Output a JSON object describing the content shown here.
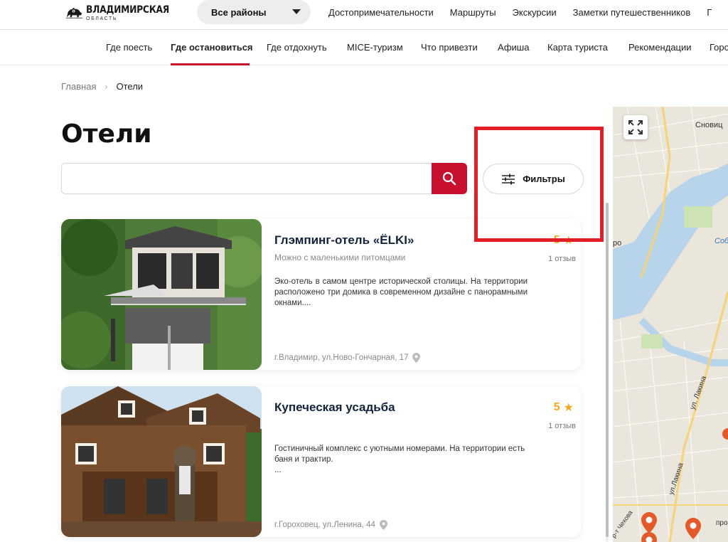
{
  "header": {
    "logo_title": "ВЛАДИМИРСКАЯ",
    "logo_subtitle": "ОБЛАСТЬ",
    "region_select": "Все районы",
    "nav": [
      "Достопримечательности",
      "Маршруты",
      "Экскурсии",
      "Заметки путешественников",
      "Г"
    ]
  },
  "subnav": {
    "items": [
      "Где поесть",
      "Где остановиться",
      "Где отдохнуть",
      "MICE-туризм",
      "Что привезти",
      "Афиша",
      "Карта туриста",
      "Рекомендации",
      "Горо"
    ],
    "active": "Где остановиться"
  },
  "breadcrumb": {
    "home": "Главная",
    "current": "Отели"
  },
  "page": {
    "title": "Отели",
    "search_placeholder": "",
    "filters_label": "Фильтры"
  },
  "hotels": [
    {
      "name": "Глэмпинг-отель «ЁLKI»",
      "tag": "Можно с маленькими питомцами",
      "description": "Эко-отель в самом центре исторической столицы. На территории расположено три домика в современном дизайне с панорамными окнами....",
      "address": "г.Владимир, ул.Ново-Гончарная, 17",
      "rating": "5",
      "reviews": "1 отзыв"
    },
    {
      "name": "Купеческая усадьба",
      "tag": "",
      "description": "Гостиничный комплекс с уютными номерами. На территории есть баня и трактир.\n...",
      "address": "г.Гороховец, ул.Ленина, 44",
      "rating": "5",
      "reviews": "1 отзыв"
    }
  ],
  "map": {
    "labels": [
      "Сновиц",
      "Соб",
      "ро",
      "ул. Лакина",
      "ул.Лакина",
      "р-т Чехова",
      "про"
    ]
  },
  "colors": {
    "accent": "#c8102e",
    "highlight": "#e41e26",
    "rating": "#f2a81d",
    "hotel_name": "#14233c"
  }
}
